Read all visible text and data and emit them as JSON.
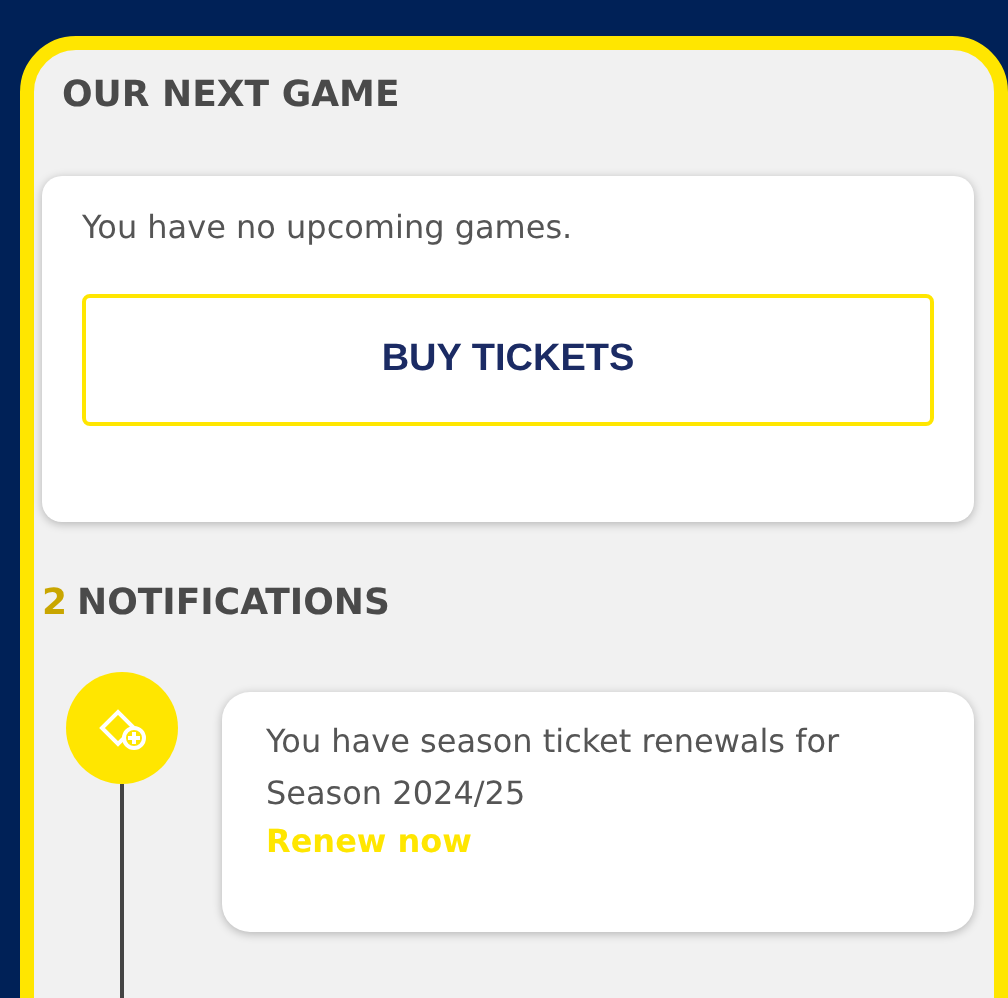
{
  "next_game": {
    "heading": "OUR NEXT GAME",
    "message": "You have no upcoming games.",
    "button": "BUY TICKETS"
  },
  "notifications": {
    "count": "2",
    "heading": "NOTIFICATIONS",
    "items": [
      {
        "text": "You have season ticket renewals for Season 2024/25",
        "link": "Renew now"
      }
    ]
  }
}
